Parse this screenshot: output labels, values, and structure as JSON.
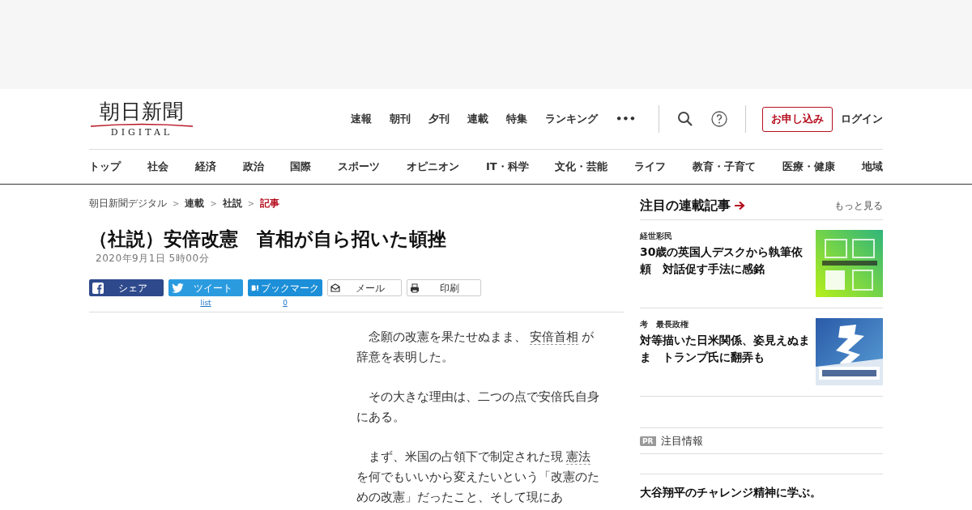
{
  "logo": {
    "title": "朝日新聞",
    "subtitle": "DIGITAL"
  },
  "top_nav": [
    "速報",
    "朝刊",
    "夕刊",
    "連載",
    "特集",
    "ランキング",
    "•••"
  ],
  "subscribe_button": "お申し込み",
  "login_link": "ログイン",
  "sections": [
    "トップ",
    "社会",
    "経済",
    "政治",
    "国際",
    "スポーツ",
    "オピニオン",
    "IT・科学",
    "文化・芸能",
    "ライフ",
    "教育・子育て",
    "医療・健康",
    "地域"
  ],
  "breadcrumb": [
    {
      "label": "朝日新聞デジタル",
      "current": false
    },
    {
      "label": "連載",
      "current": false
    },
    {
      "label": "社説",
      "current": false
    },
    {
      "label": "記事",
      "current": true
    }
  ],
  "breadcrumb_separator": ">",
  "article": {
    "title": "（社説）安倍改憲　首相が自ら招いた頓挫",
    "date": "2020年9月1日 5時00分",
    "share_buttons": [
      {
        "kind": "facebook",
        "label": "シェア"
      },
      {
        "kind": "twitter",
        "label": "ツイート",
        "count": "list"
      },
      {
        "kind": "hatena",
        "label": "ブックマーク",
        "count": "0"
      },
      {
        "kind": "mail",
        "label": "メール"
      },
      {
        "kind": "print",
        "label": "印刷"
      }
    ],
    "paragraphs": [
      [
        {
          "text": "念願の改憲を果たせぬまま、",
          "link": false
        },
        {
          "text": "安倍首相",
          "link": true
        },
        {
          "text": "が辞意を表明した。",
          "link": false
        }
      ],
      [
        {
          "text": "その大きな理由は、二つの点で安倍氏自身にある。",
          "link": false
        }
      ],
      [
        {
          "text": "まず、米国の占領下で制定された現",
          "link": false
        },
        {
          "text": "憲法",
          "link": true
        },
        {
          "text": "を何でもいいから変えたいという「改憲のための改憲」だったこと、そして現にあ",
          "link": false
        }
      ]
    ]
  },
  "sidebar": {
    "heading": "注目の連載記事",
    "more_link": "もっと見る",
    "items": [
      {
        "series": "経世彩民",
        "title": "30歳の英国人デスクから執筆依頼　対話促す手法に感銘",
        "kind": "green"
      },
      {
        "series": "考　最長政権",
        "title": "対等描いた日米関係、姿見えぬまま　トランプ氏に翻弄も",
        "kind": "blue"
      }
    ],
    "pr_badge": "PR",
    "pr_heading": "注目情報",
    "pr_title": "大谷翔平のチャレンジ精神に学ぶ。"
  }
}
